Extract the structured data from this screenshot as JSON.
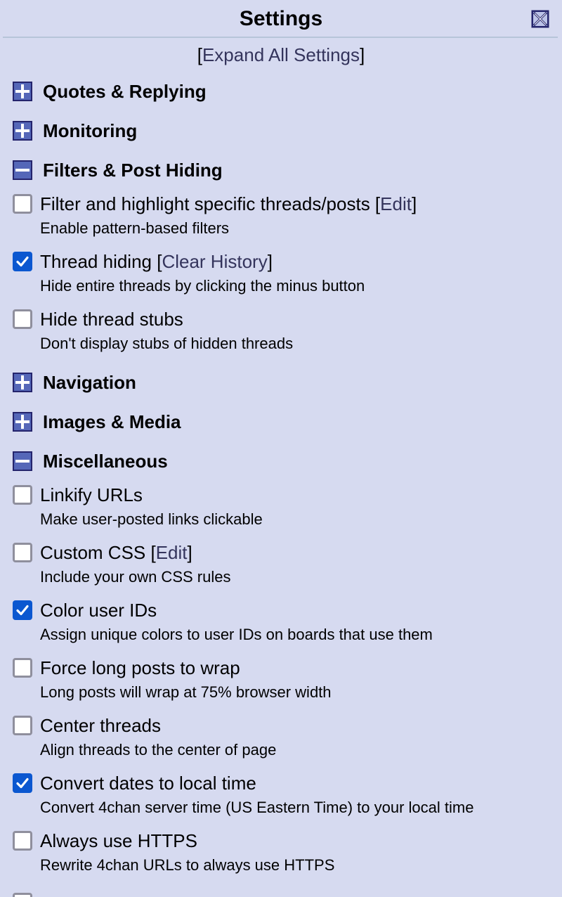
{
  "window": {
    "title": "Settings",
    "close_icon": "close-x-icon"
  },
  "expand_all": {
    "bracket_open": "[",
    "label": "Expand All Settings",
    "bracket_close": "]"
  },
  "sections": [
    {
      "title": "Quotes & Replying",
      "expanded": false,
      "icon": "plus-box-icon"
    },
    {
      "title": "Monitoring",
      "expanded": false,
      "icon": "plus-box-icon"
    },
    {
      "title": "Filters & Post Hiding",
      "expanded": true,
      "icon": "minus-box-icon",
      "options": [
        {
          "label": "Filter and highlight specific threads/posts",
          "link": "Edit",
          "desc": "Enable pattern-based filters",
          "checked": false
        },
        {
          "label": "Thread hiding",
          "link": "Clear History",
          "desc": "Hide entire threads by clicking the minus button",
          "checked": true
        },
        {
          "label": "Hide thread stubs",
          "desc": "Don't display stubs of hidden threads",
          "checked": false
        }
      ]
    },
    {
      "title": "Navigation",
      "expanded": false,
      "icon": "plus-box-icon"
    },
    {
      "title": "Images & Media",
      "expanded": false,
      "icon": "plus-box-icon"
    },
    {
      "title": "Miscellaneous",
      "expanded": true,
      "icon": "minus-box-icon",
      "options": [
        {
          "label": "Linkify URLs",
          "desc": "Make user-posted links clickable",
          "checked": false
        },
        {
          "label": "Custom CSS",
          "link": "Edit",
          "desc": "Include your own CSS rules",
          "checked": false
        },
        {
          "label": "Color user IDs",
          "desc": "Assign unique colors to user IDs on boards that use them",
          "checked": true
        },
        {
          "label": "Force long posts to wrap",
          "desc": "Long posts will wrap at 75% browser width",
          "checked": false
        },
        {
          "label": "Center threads",
          "desc": "Align threads to the center of page",
          "checked": false
        },
        {
          "label": "Convert dates to local time",
          "desc": "Convert 4chan server time (US Eastern Time) to your local time",
          "checked": true
        },
        {
          "label": "Always use HTTPS",
          "desc": "Rewrite 4chan URLs to always use HTTPS",
          "checked": false
        }
      ]
    }
  ],
  "colors": {
    "background": "#d6daf0",
    "link": "#34345c",
    "checkbox_checked": "#0b57d0",
    "checkbox_border": "#8f8f9d",
    "toggle_fill": "#5567b8",
    "toggle_border": "#24246c",
    "divider": "#b7c5d9"
  }
}
